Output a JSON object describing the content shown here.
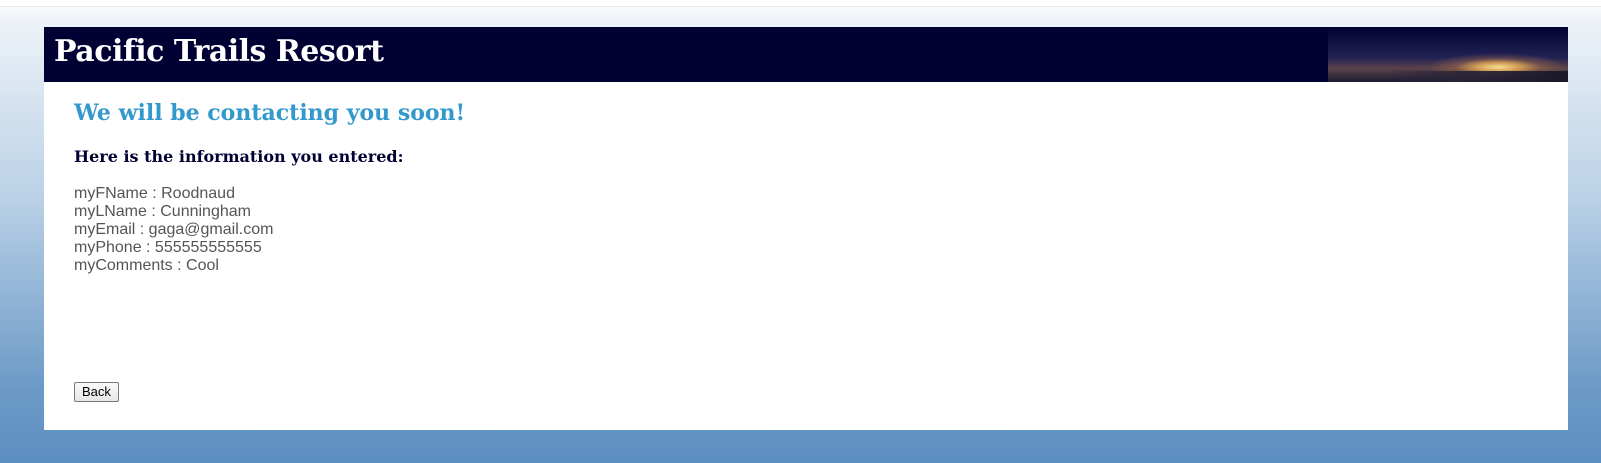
{
  "header": {
    "site_title": "Pacific Trails Resort"
  },
  "main": {
    "headline": "We will be contacting you soon!",
    "subhead": "Here is the information you entered:",
    "entries": [
      "myFName : Roodnaud",
      "myLName : Cunningham",
      "myEmail : gaga@gmail.com",
      "myPhone : 555555555555",
      "myComments : Cool"
    ],
    "back_label": "Back"
  },
  "colors": {
    "header_bg": "#000033",
    "headline": "#3399cc",
    "subhead": "#000033",
    "body_text": "#555555",
    "page_gradient_bottom": "#5b8fc0"
  }
}
